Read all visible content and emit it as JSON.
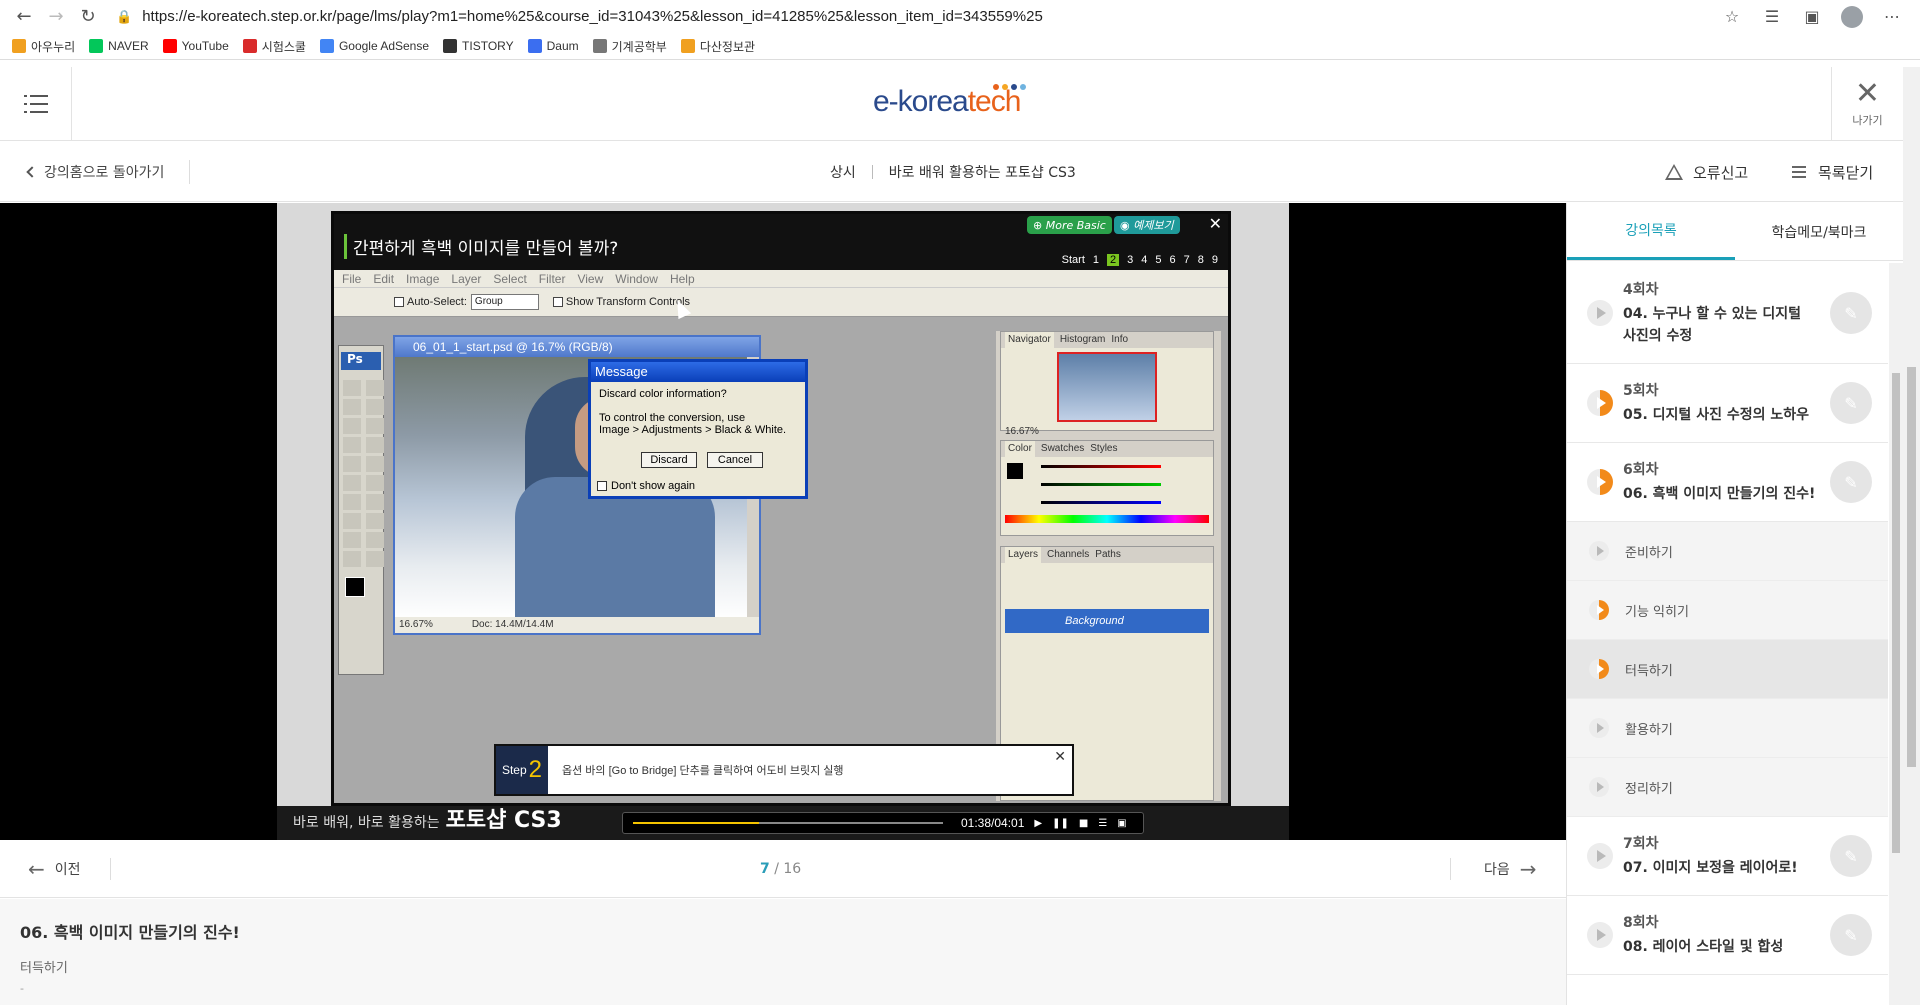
{
  "browser": {
    "url": "https://e-koreatech.step.or.kr/page/lms/play?m1=home%25&course_id=31043%25&lesson_id=41285%25&lesson_item_id=343559%25",
    "bookmarks": [
      {
        "label": "아우누리",
        "color": "#f0a020"
      },
      {
        "label": "NAVER",
        "color": "#03c75a"
      },
      {
        "label": "YouTube",
        "color": "#ff0000"
      },
      {
        "label": "시험스쿨",
        "color": "#d92b2b"
      },
      {
        "label": "Google AdSense",
        "color": "#4285f4"
      },
      {
        "label": "TISTORY",
        "color": "#333333"
      },
      {
        "label": "Daum",
        "color": "#3b6ef0"
      },
      {
        "label": "기계공학부",
        "color": "#777777"
      },
      {
        "label": "다산정보관",
        "color": "#f0a020"
      }
    ]
  },
  "header": {
    "logo_prefix": "e-korea",
    "logo_suffix": "tech",
    "exit_label": "나가기"
  },
  "subheader": {
    "back_label": "강의홈으로 돌아가기",
    "term": "상시",
    "course_name": "바로 배워 활용하는 포토샵 CS3",
    "report_label": "오류신고",
    "close_list_label": "목록닫기"
  },
  "video": {
    "title": "간편하게 흑백 이미지를 만들어 볼까?",
    "more_basic": "More Basic",
    "example": "예제보기",
    "steps_start": "Start",
    "steps": [
      "1",
      "2",
      "3",
      "4",
      "5",
      "6",
      "7",
      "8",
      "9"
    ],
    "current_step": "2",
    "menu": [
      "File",
      "Edit",
      "Image",
      "Layer",
      "Select",
      "Filter",
      "View",
      "Window",
      "Help"
    ],
    "auto_select": "Auto-Select:",
    "group": "Group",
    "show_transform": "Show Transform Controls",
    "doc_title": "06_01_1_start.psd @ 16.7% (RGB/8)",
    "doc_zoom": "16.67%",
    "doc_size": "Doc: 14.4M/14.4M",
    "msg_title": "Message",
    "msg_q": "Discard color information?",
    "msg_l1": "To control the conversion, use",
    "msg_l2": "Image > Adjustments > Black & White.",
    "msg_discard": "Discard",
    "msg_cancel": "Cancel",
    "msg_dont": "Don't show again",
    "nav_tabs": [
      "Navigator",
      "Histogram",
      "Info"
    ],
    "nav_zoom": "16.67%",
    "color_tabs": [
      "Color",
      "Swatches",
      "Styles"
    ],
    "layer_tabs": [
      "Layers",
      "Channels",
      "Paths"
    ],
    "layer_name": "Background",
    "step_label": "Step",
    "step_num": "2",
    "step_text": "옵션 바의 [Go to Bridge] 단추를 클릭하여 어도비 브릿지 실행",
    "brand_pre": "바로 배워, 바로 활용하는",
    "brand_main": "포토샵 CS3",
    "time": "01:38/04:01",
    "progress": 0.405
  },
  "pager": {
    "prev": "이전",
    "next": "다음",
    "current": "7",
    "total": "/ 16"
  },
  "lesson": {
    "title": "06. 흑백 이미지 만들기의 진수!",
    "sub": "터득하기",
    "dash": "-"
  },
  "sidebar": {
    "tabs": [
      "강의목록",
      "학습메모/북마크"
    ],
    "chapters": [
      {
        "no": "4회차",
        "title": "04. 누구나 할 수 있는 디지털 사진의 수정",
        "status": "none"
      },
      {
        "no": "5회차",
        "title": "05. 디지털 사진 수정의 노하우",
        "status": "partial"
      },
      {
        "no": "6회차",
        "title": "06. 흑백 이미지 만들기의 진수!",
        "status": "partial"
      }
    ],
    "sub_items": [
      {
        "label": "준비하기",
        "status": "none"
      },
      {
        "label": "기능 익히기",
        "status": "partial"
      },
      {
        "label": "터득하기",
        "status": "partial"
      },
      {
        "label": "활용하기",
        "status": "none"
      },
      {
        "label": "정리하기",
        "status": "none"
      }
    ],
    "chapters_after": [
      {
        "no": "7회차",
        "title": "07. 이미지 보정을 레이어로!",
        "status": "none"
      },
      {
        "no": "8회차",
        "title": "08. 레이어 스타일 및 합성",
        "status": "none"
      }
    ]
  }
}
